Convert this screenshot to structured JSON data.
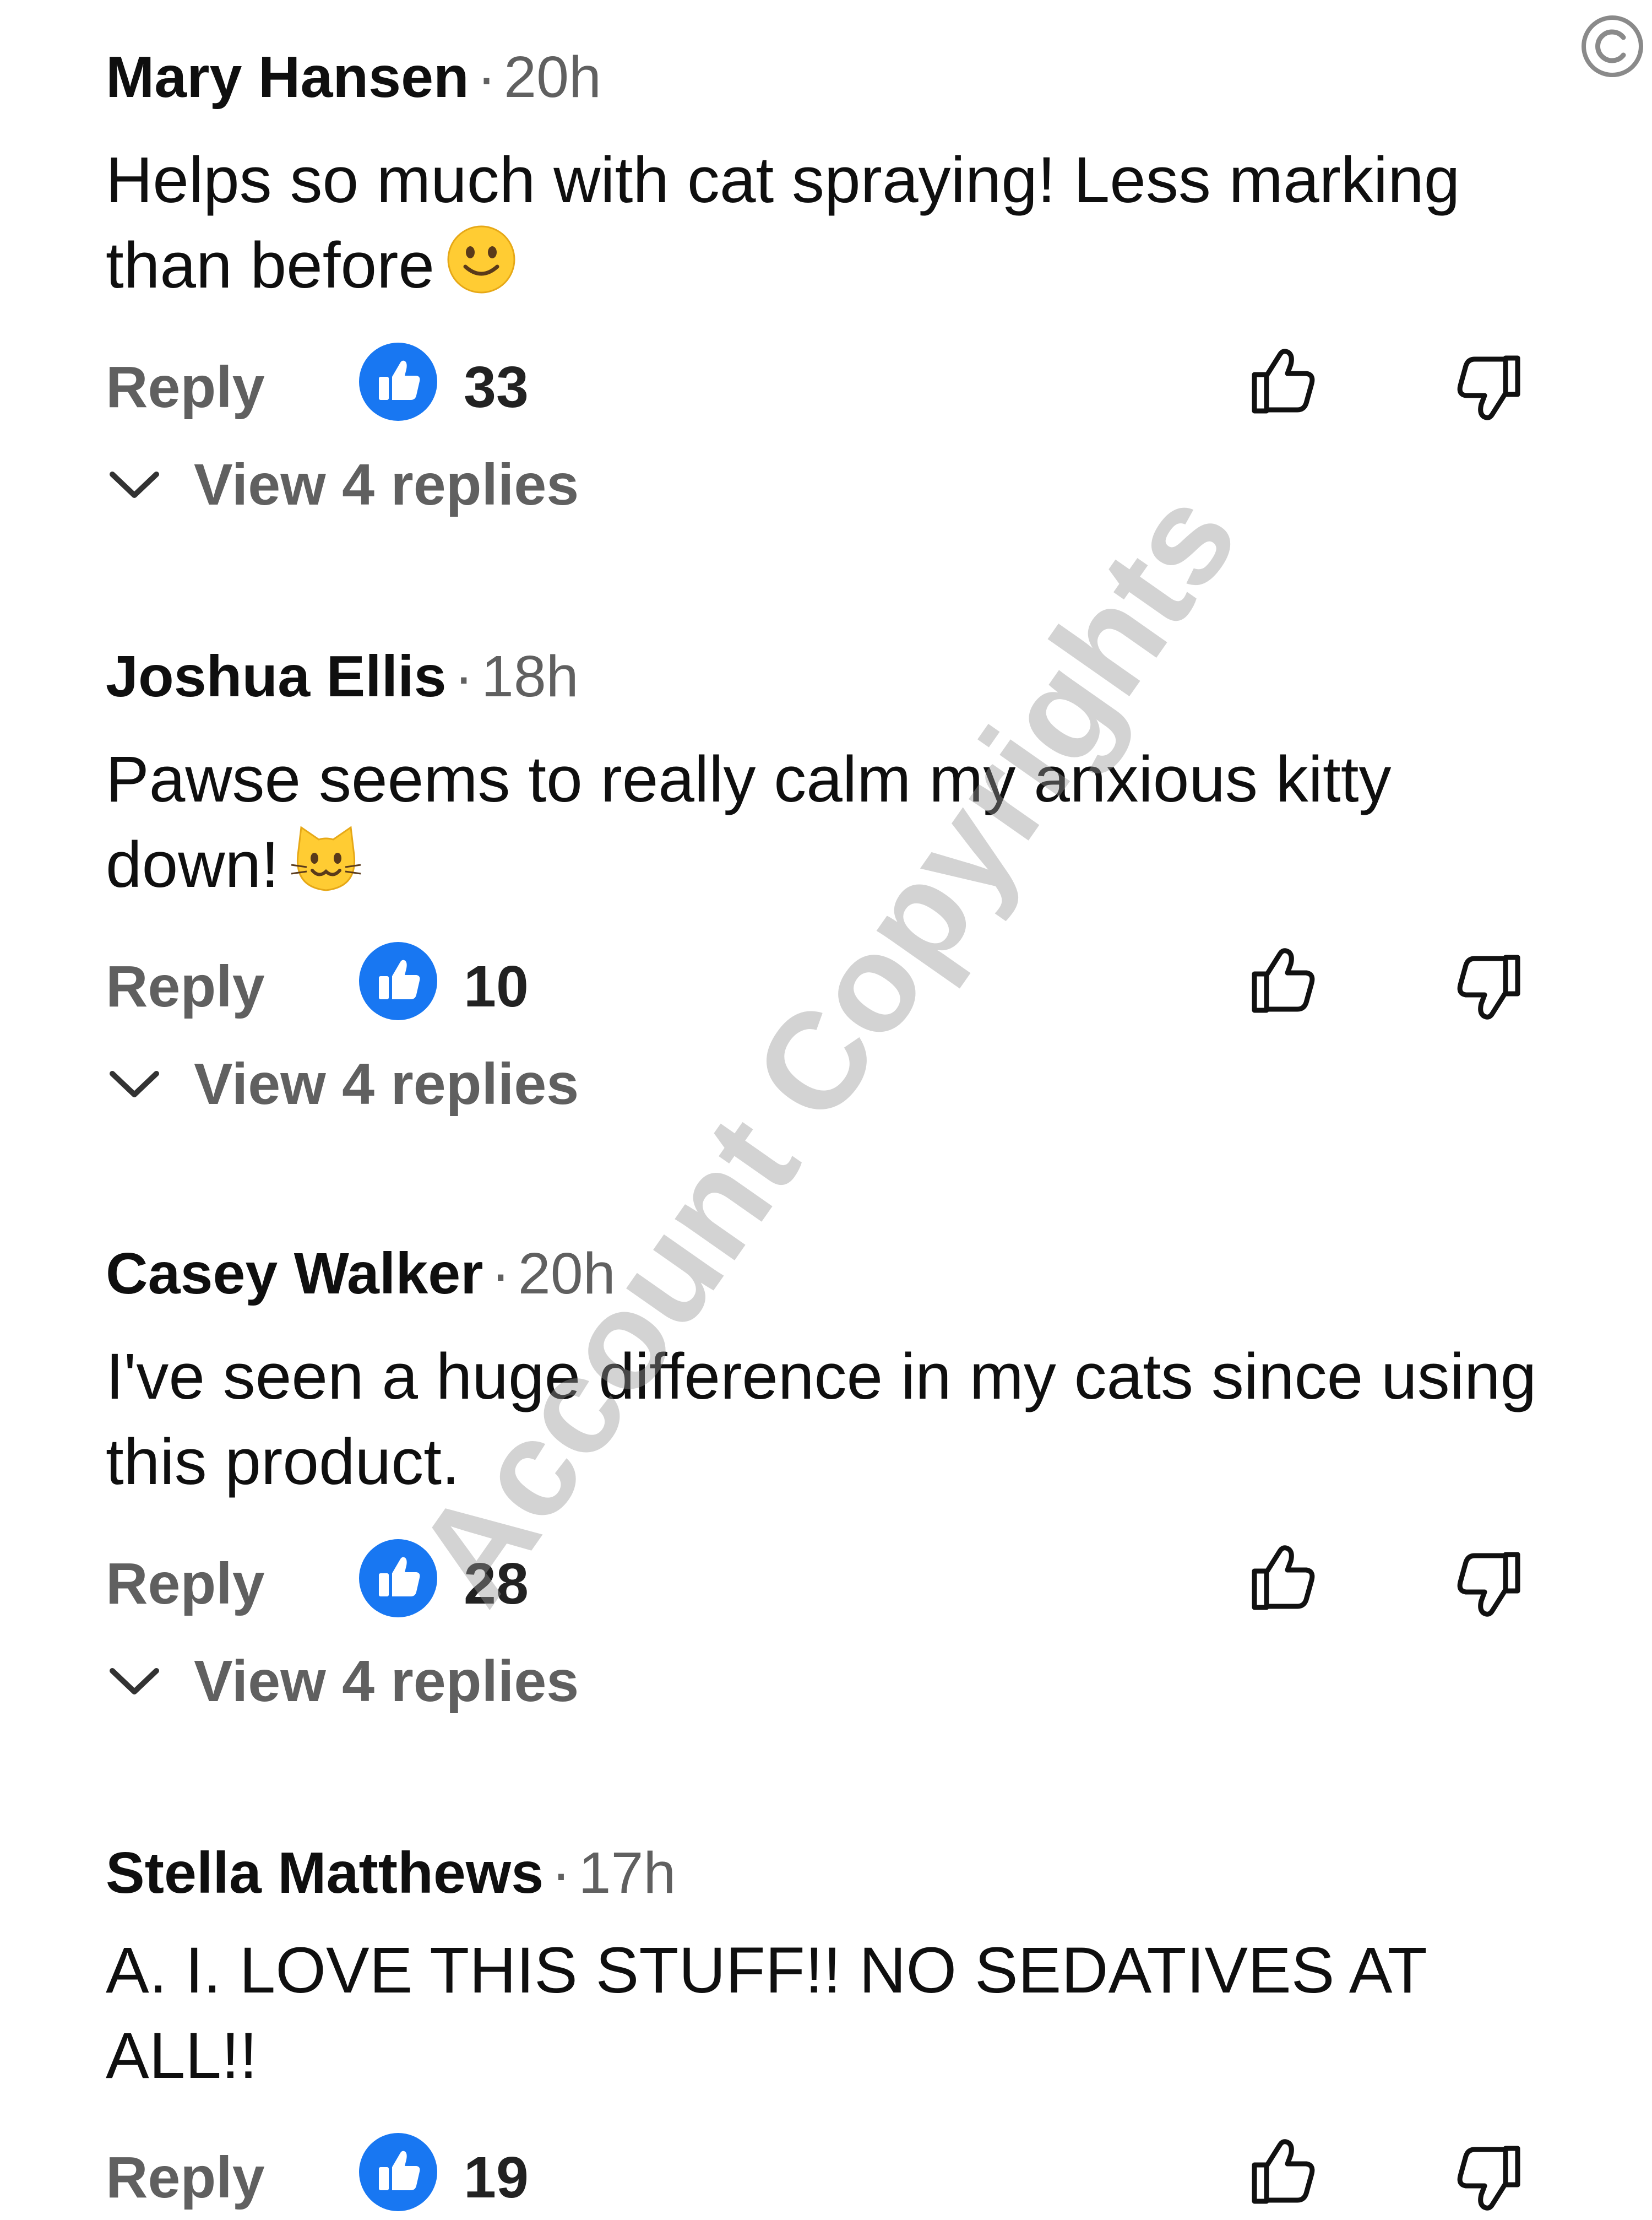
{
  "comments": [
    {
      "author": "Mary Hansen",
      "separator": "·",
      "time": "20h",
      "text": "Helps so much with cat spraying! Less marking than before",
      "emoji": "slightly-smiling-face-emoji",
      "reply_label": "Reply",
      "like_count": "33",
      "view_replies_label": "View 4 replies"
    },
    {
      "author": "Joshua Ellis",
      "separator": "·",
      "time": "18h",
      "text": "Pawse seems to really calm my anxious kitty down!",
      "emoji": "smiling-cat-face-emoji",
      "reply_label": "Reply",
      "like_count": "10",
      "view_replies_label": "View 4 replies"
    },
    {
      "author": "Casey Walker",
      "separator": "·",
      "time": "20h",
      "text": "I've seen a huge difference in my cats since using this product.",
      "reply_label": "Reply",
      "like_count": "28",
      "view_replies_label": "View 4 replies"
    },
    {
      "author": "Stella Matthews",
      "separator": "·",
      "time": "17h",
      "text": "A. I. LOVE THIS STUFF!! NO SEDATIVES AT ALL!!",
      "reply_label": "Reply",
      "like_count": "19"
    }
  ],
  "watermark_text": "Account Copyrights",
  "icons": {
    "like_badge": "like-badge-icon",
    "thumb_up": "thumb-up-icon",
    "thumb_down": "thumb-down-icon",
    "chevron": "chevron-down-icon",
    "copyright": "copyright-icon"
  },
  "colors": {
    "like_blue": "#1877F2",
    "secondary_text": "#606060",
    "primary_text": "#0F0F0F"
  }
}
